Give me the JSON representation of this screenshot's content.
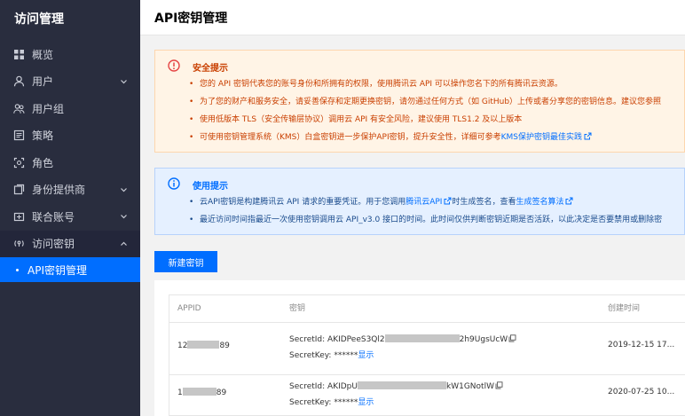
{
  "sidebar": {
    "title": "访问管理",
    "items": [
      {
        "label": "概览",
        "icon": "grid-icon"
      },
      {
        "label": "用户",
        "icon": "user-icon",
        "chevron": "down"
      },
      {
        "label": "用户组",
        "icon": "users-icon"
      },
      {
        "label": "策略",
        "icon": "policy-icon"
      },
      {
        "label": "角色",
        "icon": "role-icon"
      },
      {
        "label": "身份提供商",
        "icon": "idp-icon",
        "chevron": "down"
      },
      {
        "label": "联合账号",
        "icon": "federated-icon",
        "chevron": "down"
      },
      {
        "label": "访问密钥",
        "icon": "key-icon",
        "chevron": "up"
      }
    ],
    "active_sub": "API密钥管理"
  },
  "header": {
    "title": "API密钥管理"
  },
  "security_alert": {
    "title": "安全提示",
    "items": [
      "您的 API 密钥代表您的账号身份和所拥有的权限，使用腾讯云 API 可以操作您名下的所有腾讯云资源。",
      "为了您的财产和服务安全，请妥善保存和定期更换密钥，请勿通过任何方式（如 GitHub）上传或者分享您的密钥信息。建议您参照",
      "使用低版本 TLS（安全传输层协议）调用云 API 有安全风险，建议使用 TLS1.2 及以上版本",
      "可使用密钥管理系统（KMS）白盒密钥进一步保护API密钥，提升安全性，详细可参考"
    ],
    "kms_link": "KMS保护密钥最佳实践"
  },
  "usage_alert": {
    "title": "使用提示",
    "item1_prefix": "云API密钥是构建腾讯云 API 请求的重要凭证。用于您调用",
    "item1_link1": "腾讯云API",
    "item1_middle": "时生成签名，查看",
    "item1_link2": "生成签名算法",
    "item2": "最近访问时间指最近一次使用密钥调用云 API_v3.0 接口的时间。此时间仅供判断密钥近期是否活跃，以此决定是否要禁用或删除密"
  },
  "new_key_button": "新建密钥",
  "table": {
    "columns": [
      "APPID",
      "密钥",
      "创建时间"
    ],
    "rows": [
      {
        "appid_prefix": "12",
        "appid_suffix": "89",
        "secret_id_label": "SecretId: ",
        "secret_id_prefix": "AKIDPeeS3Ql2",
        "secret_id_suffix": "2h9UgsUcW",
        "secret_key_label": "SecretKey: ",
        "secret_key_mask": "******",
        "show_label": "显示",
        "created": "2019-12-15 17..."
      },
      {
        "appid_prefix": "1",
        "appid_suffix": "89",
        "secret_id_label": "SecretId: ",
        "secret_id_prefix": "AKIDpU",
        "secret_id_suffix": "kW1GNotlW",
        "secret_key_label": "SecretKey: ",
        "secret_key_mask": "******",
        "show_label": "显示",
        "created": "2020-07-25 10..."
      }
    ]
  },
  "colors": {
    "sidebar_bg": "#292d3e",
    "accent": "#006eff",
    "warning_text": "#c93f00",
    "warning_bg": "#fff4e6",
    "info_bg": "#e5f0ff"
  }
}
